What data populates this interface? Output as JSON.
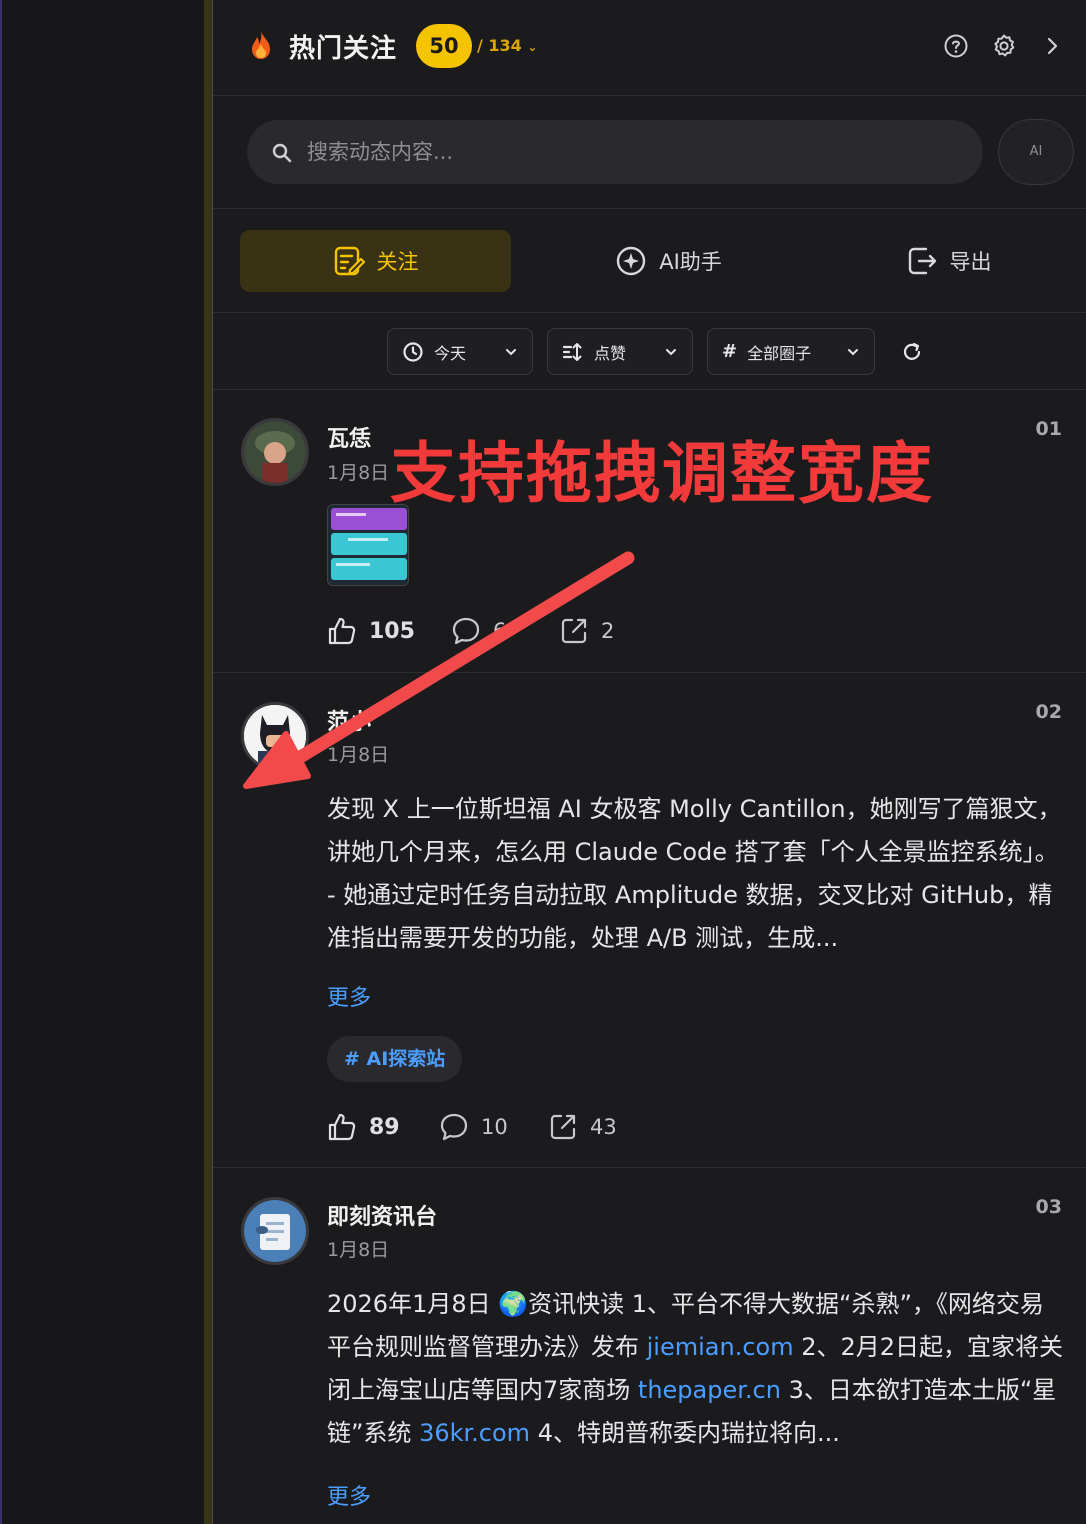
{
  "header": {
    "title": "热门关注",
    "count": "50",
    "total": "/ 134",
    "icons": [
      "help-icon",
      "settings-icon",
      "chevron-right-icon"
    ]
  },
  "search": {
    "placeholder": "搜索动态内容...",
    "ai_label": "AI"
  },
  "tabs": [
    {
      "label": "关注",
      "icon": "follow-note-icon",
      "active": true
    },
    {
      "label": "AI助手",
      "icon": "ai-sparkle-icon",
      "active": false
    },
    {
      "label": "导出",
      "icon": "export-icon",
      "active": false
    }
  ],
  "filters": {
    "time": "今天",
    "sort": "点赞",
    "circle": "全部圈子"
  },
  "posts": [
    {
      "rank": "01",
      "author": "瓦恁",
      "date": "1月8日",
      "likes": "105",
      "comments": "6",
      "shares": "2"
    },
    {
      "rank": "02",
      "author": "范小",
      "date": "1月8日",
      "text": "发现 X 上一位斯坦福 AI 女极客 Molly Cantillon，她刚写了篇狠文，讲她几个月来，怎么用 Claude Code 搭了套「个人全景监控系统」。 - 她通过定时任务自动拉取 Amplitude 数据，交叉比对 GitHub，精准指出需要开发的功能，处理 A/B 测试，生成...",
      "more": "更多",
      "tag": "# AI探索站",
      "likes": "89",
      "comments": "10",
      "shares": "43"
    },
    {
      "rank": "03",
      "author": "即刻资讯台",
      "date": "1月8日",
      "text_parts": {
        "p1": "2026年1月8日 🌍资讯快读 1、平台不得大数据“杀熟”，《网络交易平台规则监督管理办法》发布 ",
        "link1": "jiemian.com",
        "p2": " 2、2月2日起，宜家将关闭上海宝山店等国内7家商场 ",
        "link2": "thepaper.cn",
        "p3": " 3、日本欲打造本土版“星链”系统 ",
        "link3": "36kr.com",
        "p4": " 4、特朗普称委内瑞拉将向..."
      },
      "more": "更多"
    }
  ],
  "annotation": "支持拖拽调整宽度",
  "colors": {
    "accent": "#f5c400",
    "link": "#4a9eff",
    "annotation": "#f23a3a"
  }
}
